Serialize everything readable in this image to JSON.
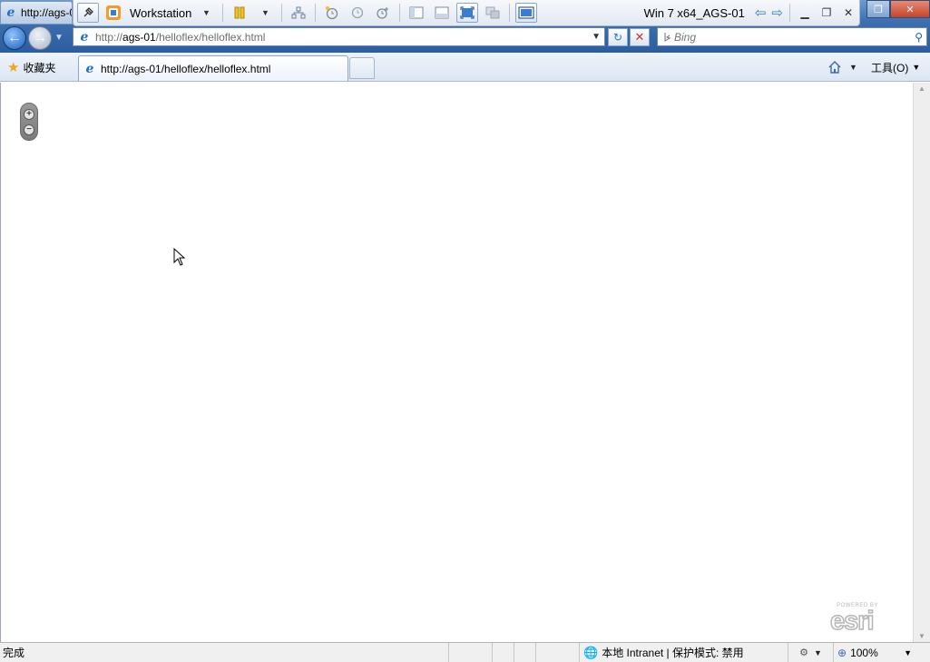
{
  "window": {
    "tab_title": "http://ags-01/helloflex/helloflex.html",
    "controls": {
      "restore": "❐",
      "minimize": "—",
      "close": "✕"
    }
  },
  "vm_toolbar": {
    "pin_icon": "pin-icon",
    "vmware_icon": "vmware-icon",
    "menu_label": "Workstation",
    "vm_name": "Win 7 x64_AGS-01"
  },
  "navigation": {
    "back_icon": "back-arrow-icon",
    "forward_icon": "forward-arrow-icon",
    "address_prefix": "http://",
    "address_host": "ags-01",
    "address_path": "/helloflex/helloflex.html",
    "search_placeholder": "Bing"
  },
  "tab_bar": {
    "favorites_label": "收藏夹",
    "active_tab_label": "http://ags-01/helloflex/helloflex.html",
    "tools_label": "工具(O)"
  },
  "map": {
    "zoom_in": "+",
    "zoom_out": "−",
    "logo_powered": "POWERED BY",
    "logo_word": "esri"
  },
  "status_bar": {
    "status_text": "完成",
    "zone_text": "本地 Intranet | 保护模式: 禁用",
    "zoom_text": "100%"
  },
  "colors": {
    "title_bar": "#3d70b0",
    "accent": "#2f7ad8",
    "stop": "#d12f2f"
  }
}
